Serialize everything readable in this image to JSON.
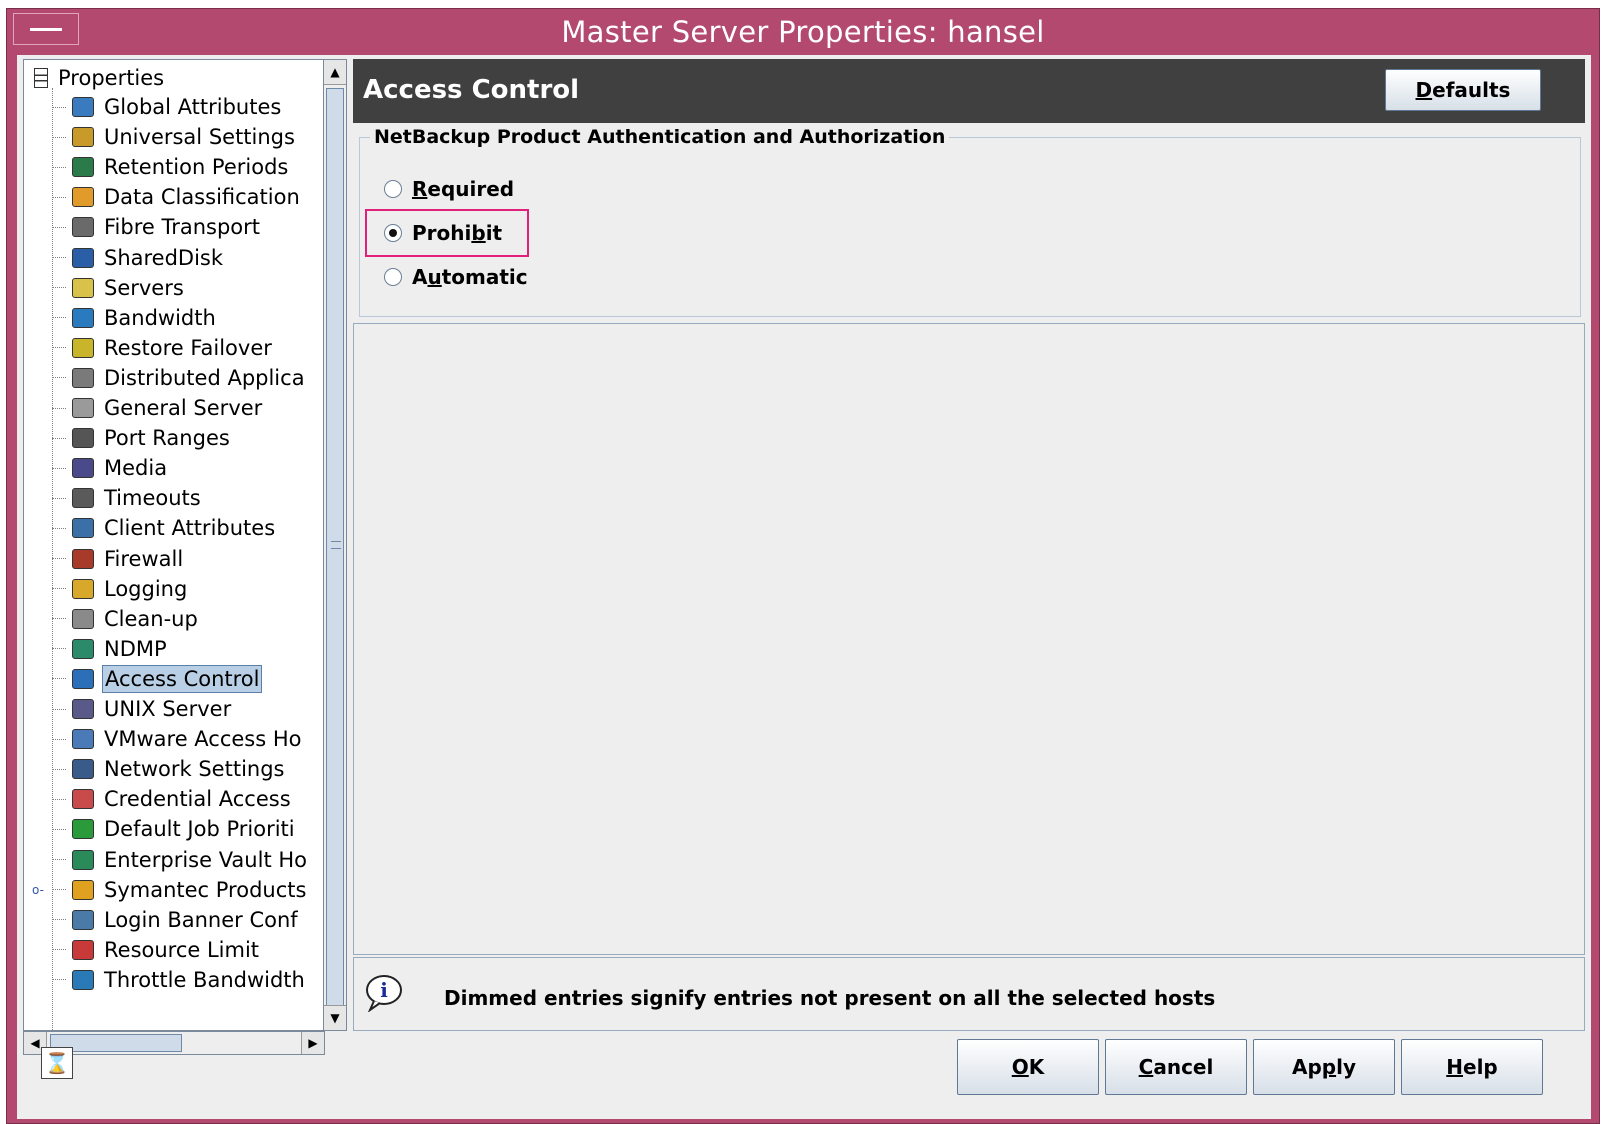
{
  "window": {
    "title": "Master Server Properties: hansel"
  },
  "tree": {
    "root": "Properties",
    "items": [
      {
        "label": "Global Attributes",
        "icon": "globe-grid-icon",
        "color": "#3a7bbf"
      },
      {
        "label": "Universal Settings",
        "icon": "gears-icon",
        "color": "#c79a2a"
      },
      {
        "label": "Retention Periods",
        "icon": "calendar-clock-icon",
        "color": "#2a7a4a"
      },
      {
        "label": "Data Classification",
        "icon": "data-classification-icon",
        "color": "#e09b2a"
      },
      {
        "label": "Fibre Transport",
        "icon": "fibre-transport-icon",
        "color": "#6a6a6a"
      },
      {
        "label": "SharedDisk",
        "icon": "shared-disk-icon",
        "color": "#2a5fa8"
      },
      {
        "label": "Servers",
        "icon": "server-icon",
        "color": "#d9c24a"
      },
      {
        "label": "Bandwidth",
        "icon": "bandwidth-icon",
        "color": "#2a7ac0"
      },
      {
        "label": "Restore Failover",
        "icon": "restore-failover-icon",
        "color": "#c9b52a"
      },
      {
        "label": "Distributed Applica",
        "icon": "distributed-app-icon",
        "color": "#7a7a7a"
      },
      {
        "label": "General Server",
        "icon": "general-server-icon",
        "color": "#9a9a9a"
      },
      {
        "label": "Port Ranges",
        "icon": "port-ranges-icon",
        "color": "#555555"
      },
      {
        "label": "Media",
        "icon": "media-icon",
        "color": "#4a4a8a"
      },
      {
        "label": "Timeouts",
        "icon": "timeout-clock-icon",
        "color": "#5a5a5a"
      },
      {
        "label": "Client Attributes",
        "icon": "client-attributes-icon",
        "color": "#3a6fa8"
      },
      {
        "label": "Firewall",
        "icon": "firewall-icon",
        "color": "#a83a2a"
      },
      {
        "label": "Logging",
        "icon": "logging-icon",
        "color": "#d8a82a"
      },
      {
        "label": "Clean-up",
        "icon": "cleanup-icon",
        "color": "#8a8a8a"
      },
      {
        "label": "NDMP",
        "icon": "ndmp-icon",
        "color": "#2a8a6a"
      },
      {
        "label": "Access Control",
        "icon": "access-control-icon",
        "color": "#2a6fb8"
      },
      {
        "label": "UNIX Server",
        "icon": "unix-server-icon",
        "color": "#5a5a8a"
      },
      {
        "label": "VMware Access Ho",
        "icon": "vmware-icon",
        "color": "#4a7ab8"
      },
      {
        "label": "Network Settings",
        "icon": "network-settings-icon",
        "color": "#3a5a8a"
      },
      {
        "label": "Credential Access",
        "icon": "credential-access-icon",
        "color": "#c84a4a"
      },
      {
        "label": "Default Job Prioriti",
        "icon": "job-priority-icon",
        "color": "#2a9a3a"
      },
      {
        "label": "Enterprise Vault Ho",
        "icon": "enterprise-vault-icon",
        "color": "#2a8a5a"
      },
      {
        "label": "Symantec Products",
        "icon": "checkmark-icon",
        "color": "#e0a020"
      },
      {
        "label": "Login Banner Conf",
        "icon": "login-banner-icon",
        "color": "#4a7aa8"
      },
      {
        "label": "Resource Limit",
        "icon": "resource-limit-icon",
        "color": "#c83a3a"
      },
      {
        "label": "Throttle Bandwidth",
        "icon": "throttle-bandwidth-icon",
        "color": "#2a7ab8"
      }
    ],
    "selected_index": 19,
    "expandable_index": 26
  },
  "panel": {
    "title": "Access Control",
    "defaults_label": "Defaults",
    "group_title": "NetBackup Product Authentication and Authorization",
    "options": [
      "Required",
      "Prohibit",
      "Automatic"
    ],
    "selected_option": "Prohibit",
    "info_text": "Dimmed entries signify entries not present on all the selected hosts"
  },
  "buttons": {
    "ok": "OK",
    "cancel": "Cancel",
    "apply": "Apply",
    "help": "Help"
  },
  "colors": {
    "titlebar": "#b3496f",
    "header": "#404040",
    "highlight": "#e0207a",
    "selection": "#b8cfe5"
  }
}
